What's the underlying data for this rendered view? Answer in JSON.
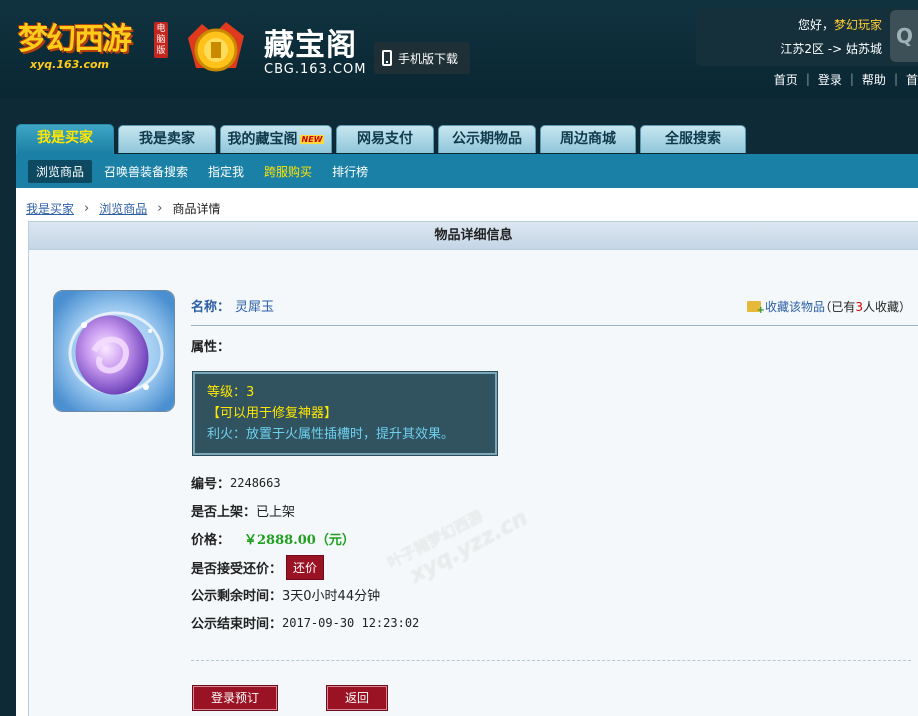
{
  "header": {
    "game_logo_text": "梦幻西游",
    "game_logo_tag": "电脑版",
    "game_logo_url": "xyq.163.com",
    "cbg_name": "藏宝阁",
    "cbg_domain": "CBG.163.COM",
    "mobile_download": "手机版下载",
    "greeting": "您好，",
    "username": "梦幻玩家",
    "server": "江苏2区 -> 姑苏城",
    "avatar_initial": "Q",
    "links": [
      "首页",
      "登录",
      "帮助",
      "首"
    ]
  },
  "tabs": [
    {
      "label": "我是买家",
      "active": true
    },
    {
      "label": "我是卖家",
      "active": false
    },
    {
      "label": "我的藏宝阁",
      "active": false,
      "badge": "NEW"
    },
    {
      "label": "网易支付",
      "active": false
    },
    {
      "label": "公示期物品",
      "active": false
    },
    {
      "label": "周边商城",
      "active": false
    },
    {
      "label": "全服搜索",
      "active": false
    }
  ],
  "subnav": [
    {
      "label": "浏览商品",
      "active": true
    },
    {
      "label": "召唤兽装备搜索"
    },
    {
      "label": "指定我"
    },
    {
      "label": "跨服购买",
      "hot": true
    },
    {
      "label": "排行榜"
    }
  ],
  "breadcrumb": [
    "我是买家",
    "浏览商品",
    "商品详情"
  ],
  "panel_title": "物品详细信息",
  "item": {
    "name_label": "名称：",
    "name": "灵犀玉",
    "favorite_label": "收藏该物品",
    "favorite_prefix": "（已有",
    "favorite_count": "3",
    "favorite_suffix": "人收藏）",
    "attr_label": "属性：",
    "attr_lines": [
      "等级：3",
      "【可以用于修复神器】",
      "利火：放置于火属性插槽时，提升其效果。"
    ],
    "serial_label": "编号：",
    "serial": "2248663",
    "listed_label": "是否上架：",
    "listed": "已上架",
    "price_label": "价格：",
    "price": "￥2888.00（元）",
    "counter_label": "是否接受还价：",
    "counter_button": "还价",
    "remaining_label": "公示剩余时间：",
    "remaining": "3天0小时44分钟",
    "end_label": "公示结束时间：",
    "end_time": "2017-09-30 12:23:02"
  },
  "actions": {
    "login_order": "登录预订",
    "back": "返回"
  },
  "watermark": {
    "line1": "叶子猪梦幻西游",
    "line2": "xyq.yzz.cn"
  }
}
